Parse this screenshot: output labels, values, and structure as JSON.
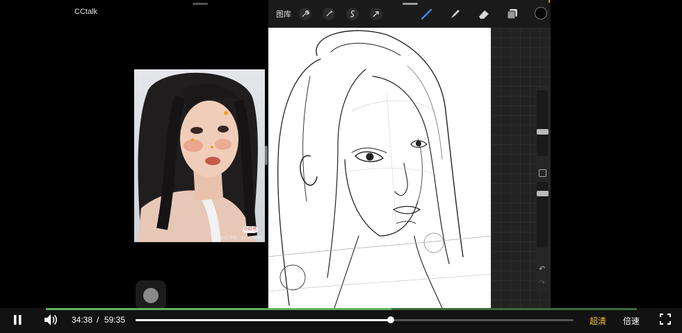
{
  "app": {
    "brand": "CCtalk"
  },
  "reference_photo": {
    "badge": "小红书",
    "caption": "小红书号：677878990"
  },
  "procreate": {
    "gallery_label": "图库",
    "toolbar_icons": [
      "wrench-icon",
      "magic-wand-icon",
      "selection-icon",
      "transform-arrow-icon"
    ],
    "tools": [
      "brush-icon",
      "smudge-icon",
      "eraser-icon",
      "layers-icon",
      "color-swatch-icon"
    ],
    "side": {
      "undo": "↶",
      "redo": "↷"
    }
  },
  "player": {
    "current_time": "34:38",
    "separator": "/",
    "total_time": "59:35",
    "quality_label": "超清",
    "speed_label": "倍速",
    "progress_fraction": 0.582,
    "colors": {
      "accent": "#f0c040",
      "progress": "#5fb25f"
    }
  }
}
